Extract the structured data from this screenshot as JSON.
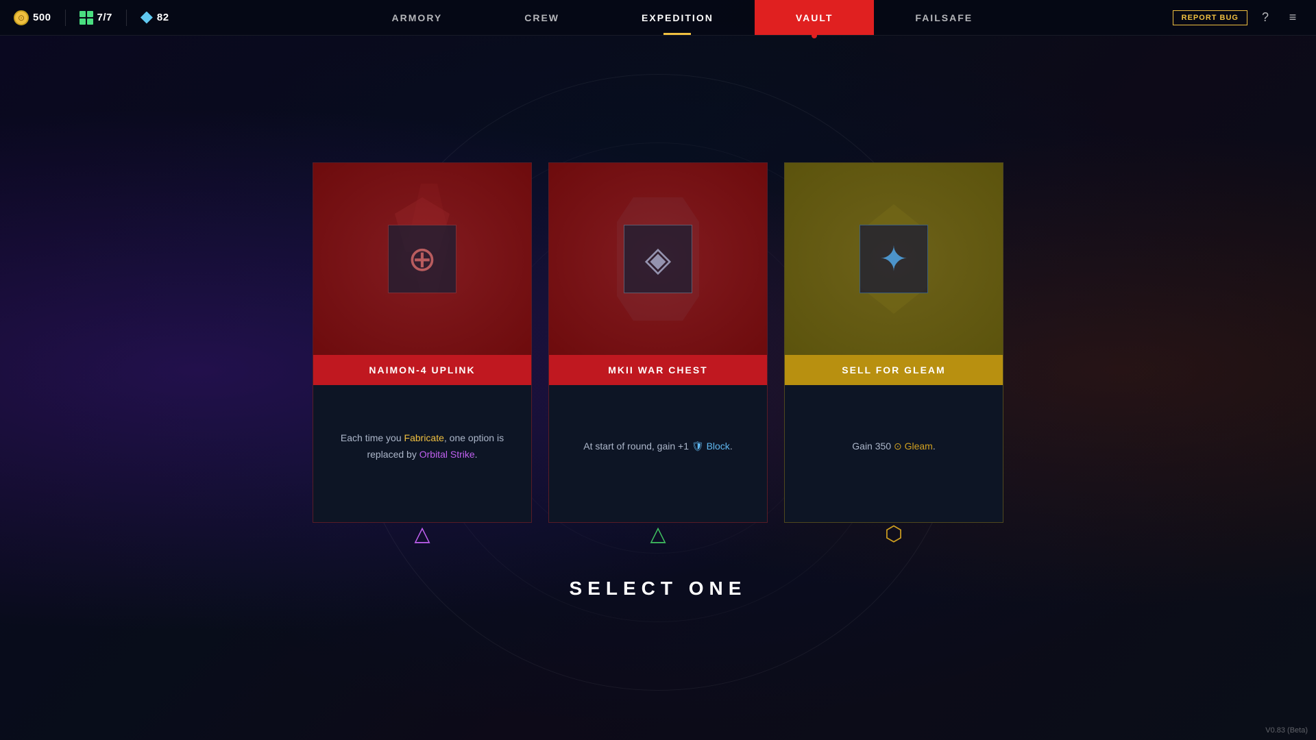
{
  "nav": {
    "tabs": [
      {
        "id": "armory",
        "label": "ARMORY",
        "active": false
      },
      {
        "id": "crew",
        "label": "CREW",
        "active": false
      },
      {
        "id": "expedition",
        "label": "EXPEDITION",
        "active": true
      },
      {
        "id": "vault",
        "label": "VAULT",
        "active_highlight": true
      },
      {
        "id": "failsafe",
        "label": "FAILSAFE",
        "active": false
      }
    ],
    "currency": {
      "gold_value": "500",
      "grid_value": "7/7",
      "diamond_value": "82"
    },
    "report_bug_label": "REPORT BUG"
  },
  "cards": [
    {
      "id": "naimon",
      "type": "red",
      "title": "NAIMON-4 UPLINK",
      "description_parts": [
        {
          "text": "Each time you ",
          "style": "normal"
        },
        {
          "text": "Fabricate",
          "style": "yellow"
        },
        {
          "text": ", one option is replaced by ",
          "style": "normal"
        },
        {
          "text": "Orbital Strike",
          "style": "purple"
        },
        {
          "text": ".",
          "style": "normal"
        }
      ],
      "icon_type": "triangle",
      "icon_color": "purple"
    },
    {
      "id": "mkii",
      "type": "red",
      "title": "MKII WAR CHEST",
      "description_parts": [
        {
          "text": "At start of round, gain +1 ",
          "style": "normal"
        },
        {
          "text": "🛡",
          "style": "blue"
        },
        {
          "text": " Block",
          "style": "blue"
        },
        {
          "text": ".",
          "style": "normal"
        }
      ],
      "icon_type": "triangle",
      "icon_color": "green"
    },
    {
      "id": "gleam",
      "type": "gold",
      "title": "SELL FOR GLEAM",
      "description_parts": [
        {
          "text": "Gain 350 ",
          "style": "normal"
        },
        {
          "text": "⊙",
          "style": "gold"
        },
        {
          "text": " Gleam",
          "style": "gold"
        },
        {
          "text": ".",
          "style": "normal"
        }
      ],
      "icon_type": "hex",
      "icon_color": "gold"
    }
  ],
  "select_one_label": "SELECT ONE",
  "version_label": "V0.83 (Beta)"
}
